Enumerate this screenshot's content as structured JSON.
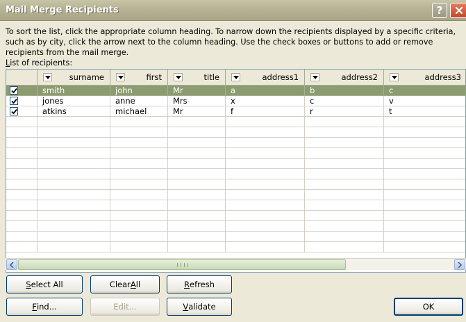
{
  "window": {
    "title": "Mail Merge Recipients",
    "help_glyph": "?"
  },
  "instructions": "To sort the list, click the appropriate column heading.  To narrow down the recipients displayed by a specific criteria, such as by city, click the arrow next to the column heading.  Use the check boxes or buttons to add or remove recipients from the mail merge.",
  "list_label": {
    "accel": "L",
    "rest": "ist of recipients:"
  },
  "table": {
    "columns": [
      "surname",
      "first",
      "title",
      "address1",
      "address2",
      "address3"
    ],
    "rows": [
      {
        "checked": true,
        "selected": true,
        "cells": [
          "smith",
          "john",
          "Mr",
          "a",
          "b",
          "c"
        ]
      },
      {
        "checked": true,
        "selected": false,
        "cells": [
          "jones",
          "anne",
          "Mrs",
          "x",
          "c",
          "v"
        ]
      },
      {
        "checked": true,
        "selected": false,
        "cells": [
          "atkins",
          "michael",
          "Mr",
          "f",
          "r",
          "t"
        ]
      }
    ]
  },
  "buttons": {
    "select_all": {
      "accel": "S",
      "rest": "elect All"
    },
    "clear_all": {
      "pre": "Clear ",
      "accel": "A",
      "rest": "ll"
    },
    "refresh": {
      "accel": "R",
      "rest": "efresh"
    },
    "find": {
      "accel": "F",
      "rest": "ind..."
    },
    "edit": {
      "label": "Edit..."
    },
    "validate": {
      "accel": "V",
      "rest": "alidate"
    },
    "ok": {
      "label": "OK"
    }
  },
  "colors": {
    "selection": "#8c9c70",
    "dialog_bg": "#ece9d8",
    "button_border": "#003c74"
  }
}
